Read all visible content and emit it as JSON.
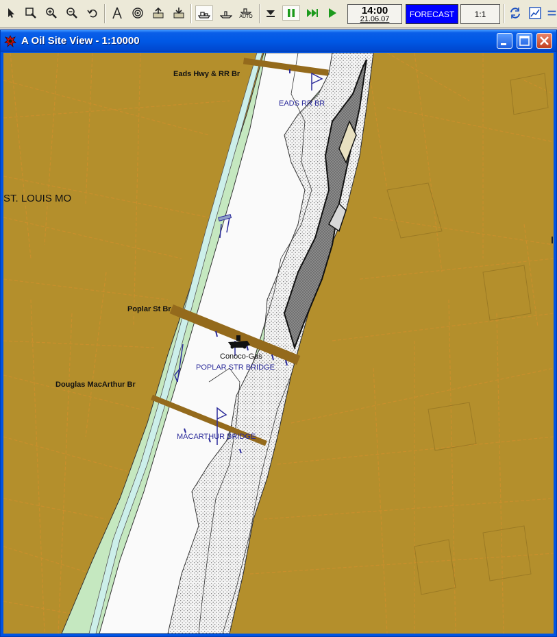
{
  "toolbar": {
    "buttons": [
      {
        "name": "select-arrow-icon"
      },
      {
        "name": "zoom-window-icon"
      },
      {
        "name": "zoom-in-icon"
      },
      {
        "name": "zoom-out-icon"
      },
      {
        "name": "undo-view-icon"
      },
      {
        "name": "compass-icon"
      },
      {
        "name": "target-icon"
      },
      {
        "name": "export-icon"
      },
      {
        "name": "import-icon"
      },
      {
        "name": "ship-view-icon"
      },
      {
        "name": "vessel-icon"
      },
      {
        "name": "auto-mode-icon"
      },
      {
        "name": "dropdown-icon"
      },
      {
        "name": "pause-icon"
      },
      {
        "name": "fast-forward-icon"
      },
      {
        "name": "play-icon"
      },
      {
        "name": "refresh-icon"
      },
      {
        "name": "chart-icon"
      }
    ],
    "auto_label": "AUTO",
    "clock_time": "14:00",
    "clock_date": "21.06.07",
    "forecast_label": "FORECAST",
    "scale_label": "1:1"
  },
  "window": {
    "title": "A Oil Site View - 1:10000",
    "app_icon": "spill-icon"
  },
  "map": {
    "labels": {
      "eads_road": "Eads Hwy & RR Br",
      "eads_bridge": "EADS RR BR",
      "city": "ST. LOUIS MO",
      "poplar_road": "Poplar St Br",
      "conoco": "Conoco-Gas",
      "poplar_bridge": "POPLAR STR BRIDGE",
      "macarthur_road": "Douglas MacArthur Br",
      "macarthur_bridge": "MACARTHUR BRIDGE"
    },
    "colors": {
      "land": "#b48f2c",
      "water": "#fafafa",
      "shallow": "#ccefea",
      "bank": "#c5e8c0",
      "bridge": "#946a1c",
      "road_lines": "#c98f2c",
      "label_blue": "#2a2a9a"
    }
  }
}
